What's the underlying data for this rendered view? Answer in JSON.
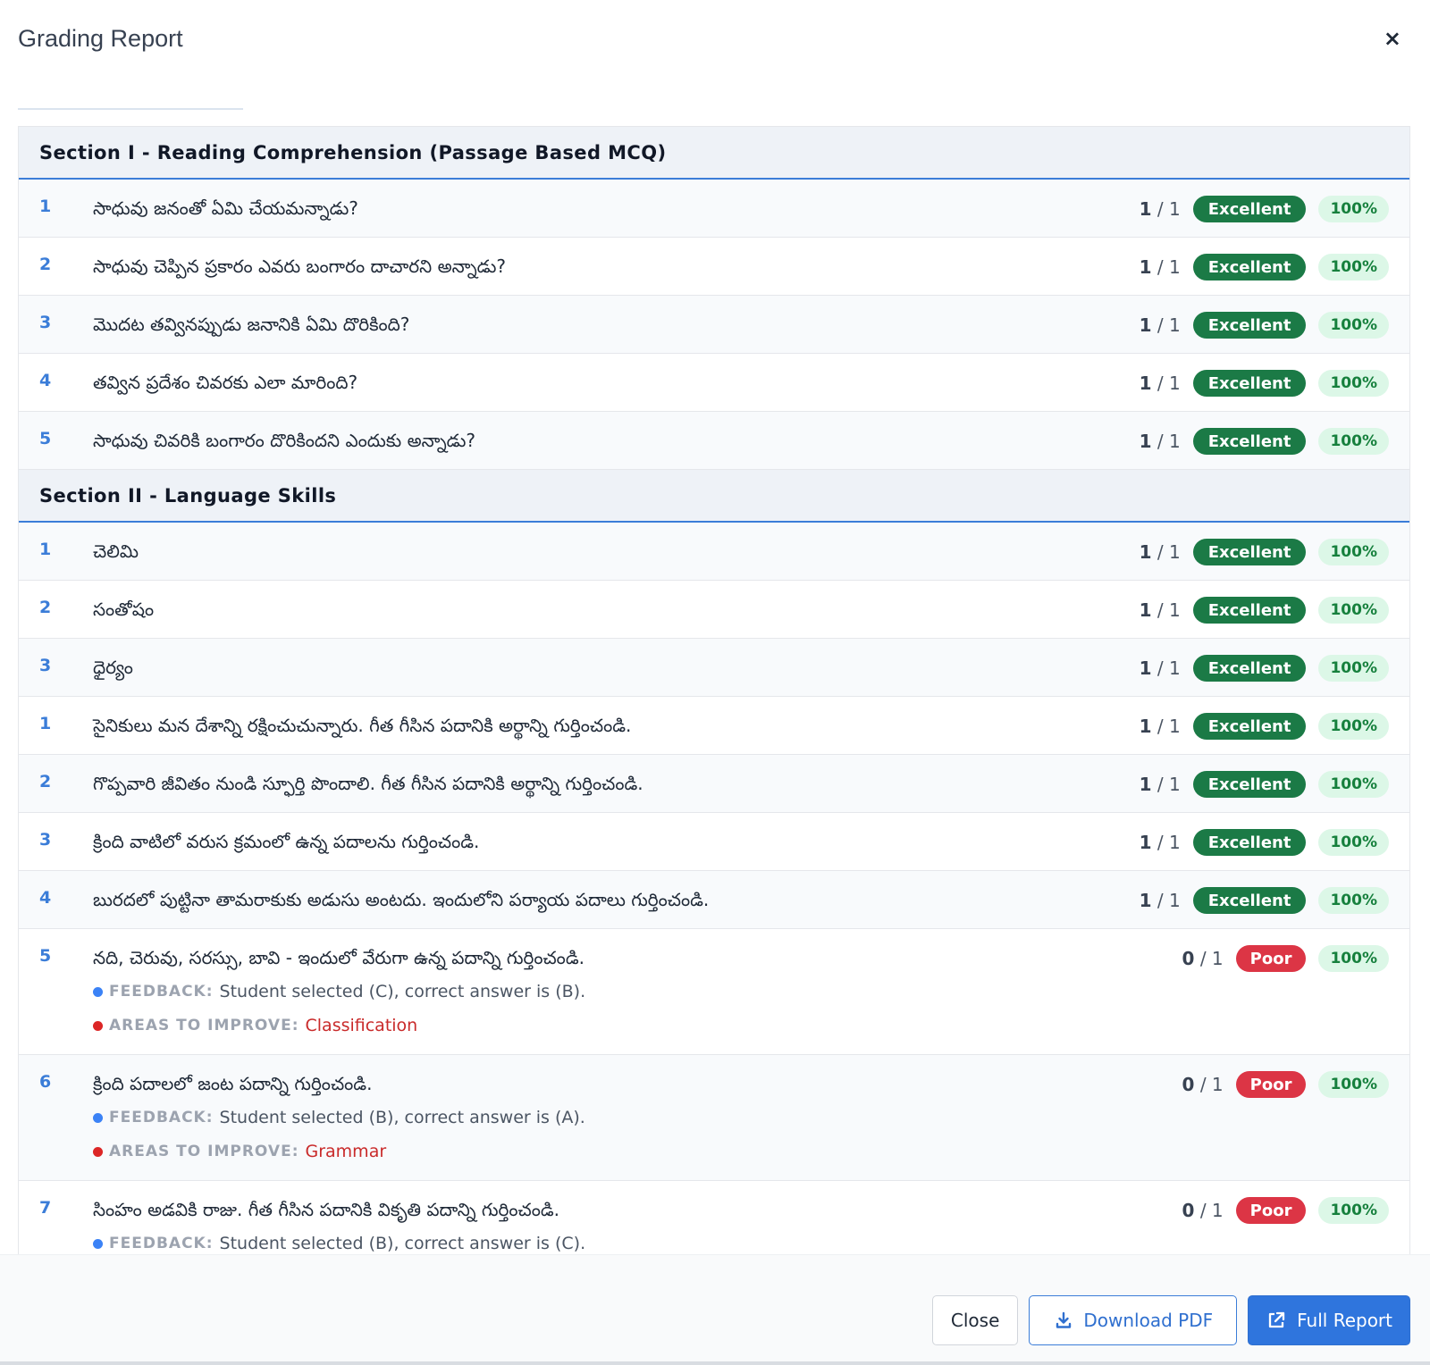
{
  "header": {
    "title": "Grading Report",
    "close_glyph": "×"
  },
  "sections": [
    {
      "title": "Section I - Reading Comprehension (Passage Based MCQ)",
      "rows": [
        {
          "num": "1",
          "text": "సాధువు జనంతో ఏమి చేయమన్నాడు?",
          "score": "1",
          "max": "1",
          "badge": "Excellent",
          "pct": "100%"
        },
        {
          "num": "2",
          "text": "సాధువు చెప్పిన ప్రకారం ఎవరు బంగారం దాచారని అన్నాడు?",
          "score": "1",
          "max": "1",
          "badge": "Excellent",
          "pct": "100%"
        },
        {
          "num": "3",
          "text": "మొదట తవ్వినప్పుడు జనానికి ఏమి దొరికింది?",
          "score": "1",
          "max": "1",
          "badge": "Excellent",
          "pct": "100%"
        },
        {
          "num": "4",
          "text": "తవ్విన ప్రదేశం చివరకు ఎలా మారింది?",
          "score": "1",
          "max": "1",
          "badge": "Excellent",
          "pct": "100%"
        },
        {
          "num": "5",
          "text": "సాధువు చివరికి బంగారం దొరికిందని ఎందుకు అన్నాడు?",
          "score": "1",
          "max": "1",
          "badge": "Excellent",
          "pct": "100%"
        }
      ]
    },
    {
      "title": "Section II - Language Skills",
      "rows": [
        {
          "num": "1",
          "text": "చెలిమి",
          "score": "1",
          "max": "1",
          "badge": "Excellent",
          "pct": "100%"
        },
        {
          "num": "2",
          "text": "సంతోషం",
          "score": "1",
          "max": "1",
          "badge": "Excellent",
          "pct": "100%"
        },
        {
          "num": "3",
          "text": "ధైర్యం",
          "score": "1",
          "max": "1",
          "badge": "Excellent",
          "pct": "100%"
        },
        {
          "num": "1",
          "text": "సైనికులు మన దేశాన్ని రక్షించుచున్నారు. గీత గీసిన పదానికి అర్థాన్ని గుర్తించండి.",
          "score": "1",
          "max": "1",
          "badge": "Excellent",
          "pct": "100%"
        },
        {
          "num": "2",
          "text": "గొప్పవారి జీవితం నుండి స్ఫూర్తి పొందాలి. గీత గీసిన పదానికి అర్థాన్ని గుర్తించండి.",
          "score": "1",
          "max": "1",
          "badge": "Excellent",
          "pct": "100%"
        },
        {
          "num": "3",
          "text": "క్రింది వాటిలో వరుస క్రమంలో ఉన్న పదాలను గుర్తించండి.",
          "score": "1",
          "max": "1",
          "badge": "Excellent",
          "pct": "100%"
        },
        {
          "num": "4",
          "text": "బురదలో పుట్టినా తామరాకుకు అడుసు అంటదు. ఇందులోని పర్యాయ పదాలు గుర్తించండి.",
          "score": "1",
          "max": "1",
          "badge": "Excellent",
          "pct": "100%"
        },
        {
          "num": "5",
          "text": "నది, చెరువు, సరస్సు, బావి - ఇందులో వేరుగా ఉన్న పదాన్ని గుర్తించండి.",
          "score": "0",
          "max": "1",
          "badge": "Poor",
          "pct": "100%",
          "feedback": "Student selected (C), correct answer is (B).",
          "improve": "Classification"
        },
        {
          "num": "6",
          "text": "క్రింది పదాలలో జంట పదాన్ని గుర్తించండి.",
          "score": "0",
          "max": "1",
          "badge": "Poor",
          "pct": "100%",
          "feedback": "Student selected (B), correct answer is (A).",
          "improve": "Grammar"
        },
        {
          "num": "7",
          "text": "సింహం అడవికి రాజు. గీత గీసిన పదానికి వికృతి పదాన్ని గుర్తించండి.",
          "score": "0",
          "max": "1",
          "badge": "Poor",
          "pct": "100%",
          "feedback": "Student selected (B), correct answer is (C)."
        }
      ]
    }
  ],
  "labels": {
    "feedback": "FEEDBACK:",
    "improve": "AREAS TO IMPROVE:",
    "score_sep": "/"
  },
  "footer": {
    "close": "Close",
    "download": "Download PDF",
    "full_report": "Full Report"
  },
  "icons": {
    "download": "download-icon",
    "external": "external-link-icon"
  },
  "colors": {
    "accent": "#2f75dd",
    "excellent": "#1b7a46",
    "poor": "#dc3545",
    "pct_bg": "#dcf7e7"
  }
}
